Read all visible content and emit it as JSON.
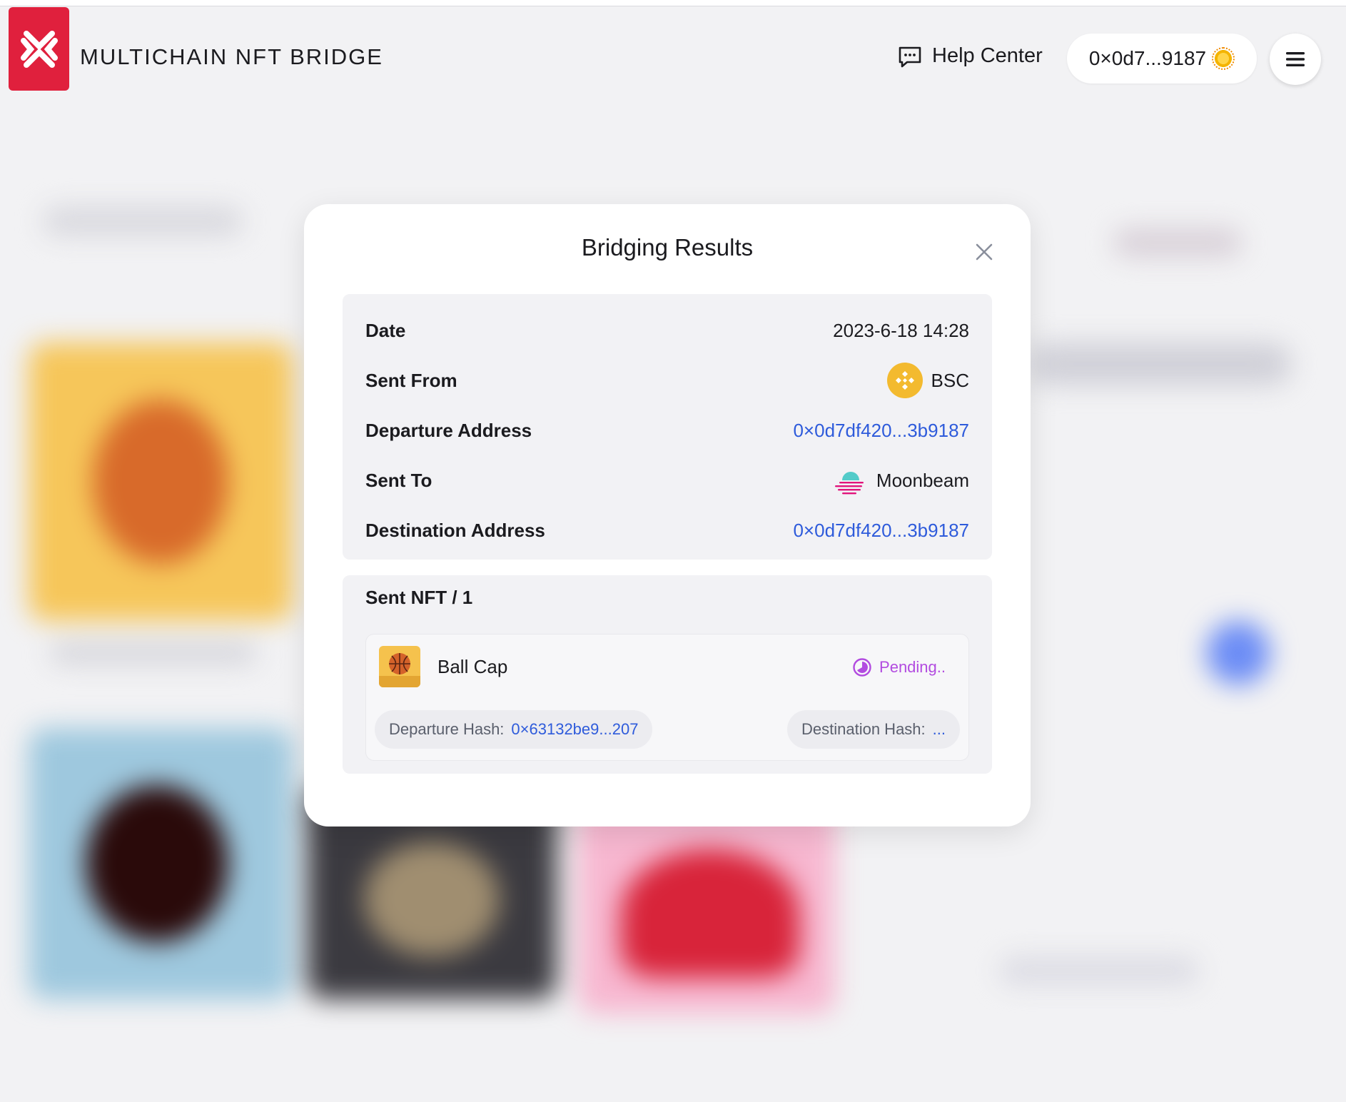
{
  "header": {
    "brand": "MULTICHAIN NFT BRIDGE",
    "help_label": "Help Center",
    "wallet_address": "0×0d7...9187"
  },
  "modal": {
    "title": "Bridging Results",
    "details": {
      "date_label": "Date",
      "date_value": "2023-6-18 14:28",
      "sent_from_label": "Sent From",
      "sent_from_value": "BSC",
      "departure_address_label": "Departure Address",
      "departure_address_value": "0×0d7df420...3b9187",
      "sent_to_label": "Sent To",
      "sent_to_value": "Moonbeam",
      "destination_address_label": "Destination Address",
      "destination_address_value": "0×0d7df420...3b9187"
    },
    "nft_section": {
      "heading": "Sent NFT / 1",
      "items": [
        {
          "name": "Ball Cap",
          "status": "Pending..",
          "departure_hash_label": "Departure Hash:",
          "departure_hash_value": "0×63132be9...207",
          "destination_hash_label": "Destination Hash:",
          "destination_hash_value": "..."
        }
      ]
    }
  },
  "colors": {
    "brand_red": "#e0203d",
    "link_blue": "#2e5bdb",
    "pending_purple": "#b24be0",
    "bsc_yellow": "#f3ba2f"
  },
  "icons": [
    "logo-icon",
    "chat-bubble-icon",
    "wallet-avatar-icon",
    "hamburger-menu-icon",
    "close-icon",
    "bsc-icon",
    "moonbeam-icon",
    "nft-thumbnail-icon",
    "pending-icon"
  ]
}
